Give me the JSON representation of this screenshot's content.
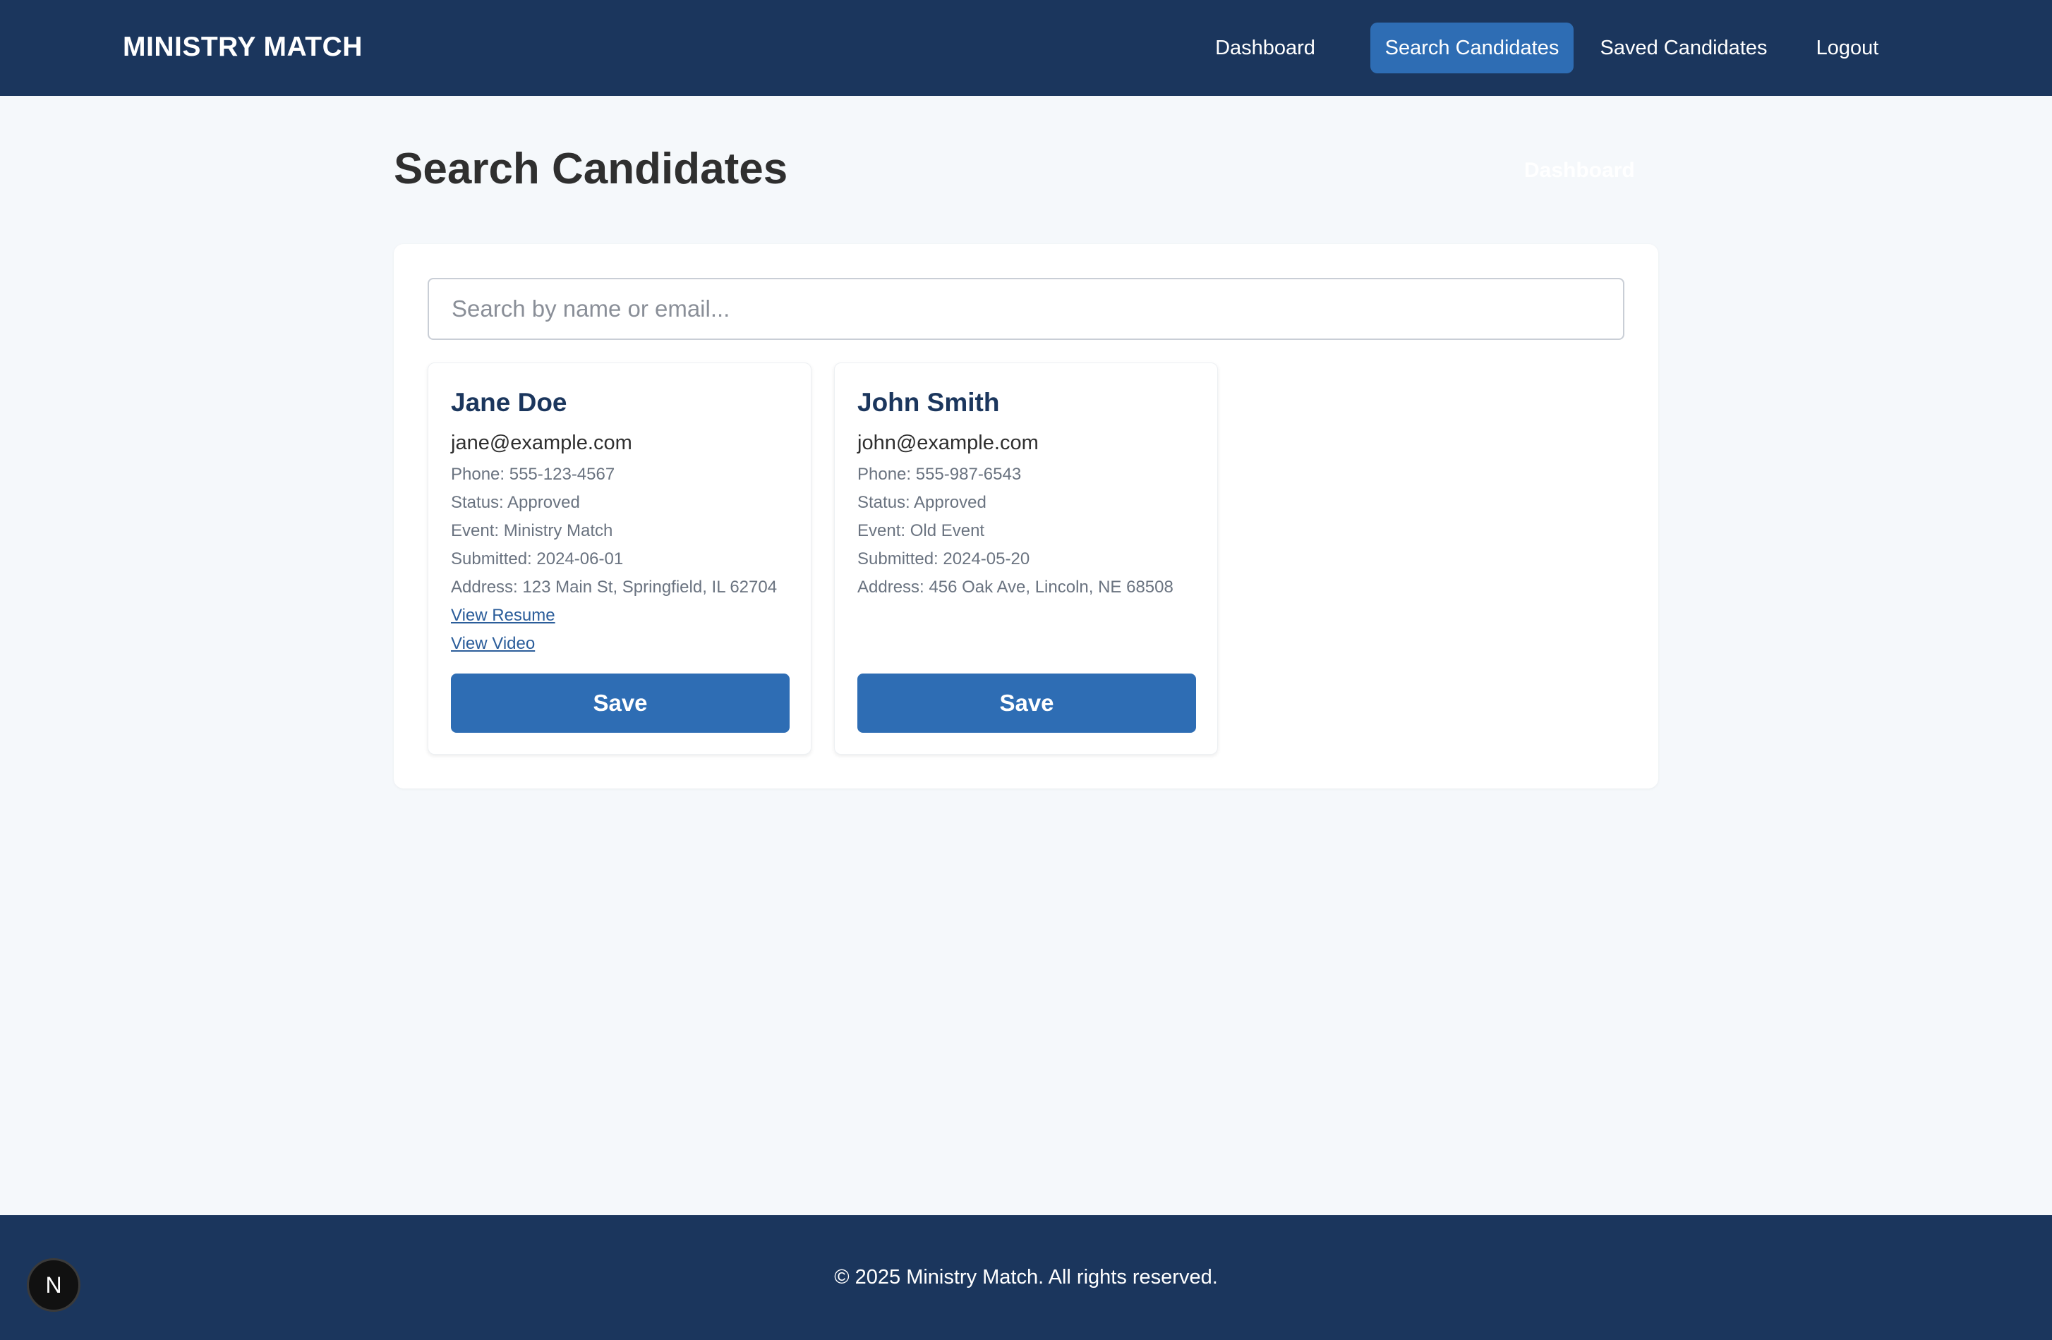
{
  "header": {
    "brand": "MINISTRY MATCH",
    "nav": [
      {
        "label": "Dashboard",
        "active": false
      },
      {
        "label": "Search Candidates",
        "active": true
      },
      {
        "label": "Saved Candidates",
        "active": false
      },
      {
        "label": "Logout",
        "active": false
      }
    ]
  },
  "main": {
    "title": "Search Candidates",
    "ghost_link": "Dashboard",
    "search": {
      "placeholder": "Search by name or email...",
      "value": ""
    },
    "candidates": [
      {
        "name": "Jane Doe",
        "email": "jane@example.com",
        "phone": "Phone: 555-123-4567",
        "status": "Status: Approved",
        "event": "Event: Ministry Match",
        "submitted": "Submitted: 2024-06-01",
        "address": "Address: 123 Main St, Springfield, IL 62704",
        "resume_link": "View Resume",
        "video_link": "View Video",
        "save_label": "Save"
      },
      {
        "name": "John Smith",
        "email": "john@example.com",
        "phone": "Phone: 555-987-6543",
        "status": "Status: Approved",
        "event": "Event: Old Event",
        "submitted": "Submitted: 2024-05-20",
        "address": "Address: 456 Oak Ave, Lincoln, NE 68508",
        "save_label": "Save"
      }
    ]
  },
  "footer": {
    "text": "© 2025 Ministry Match. All rights reserved."
  },
  "dev_badge": {
    "label": "N"
  },
  "colors": {
    "header_bg": "#1b365d",
    "accent": "#2e6db4",
    "page_bg": "#f5f8fb"
  }
}
